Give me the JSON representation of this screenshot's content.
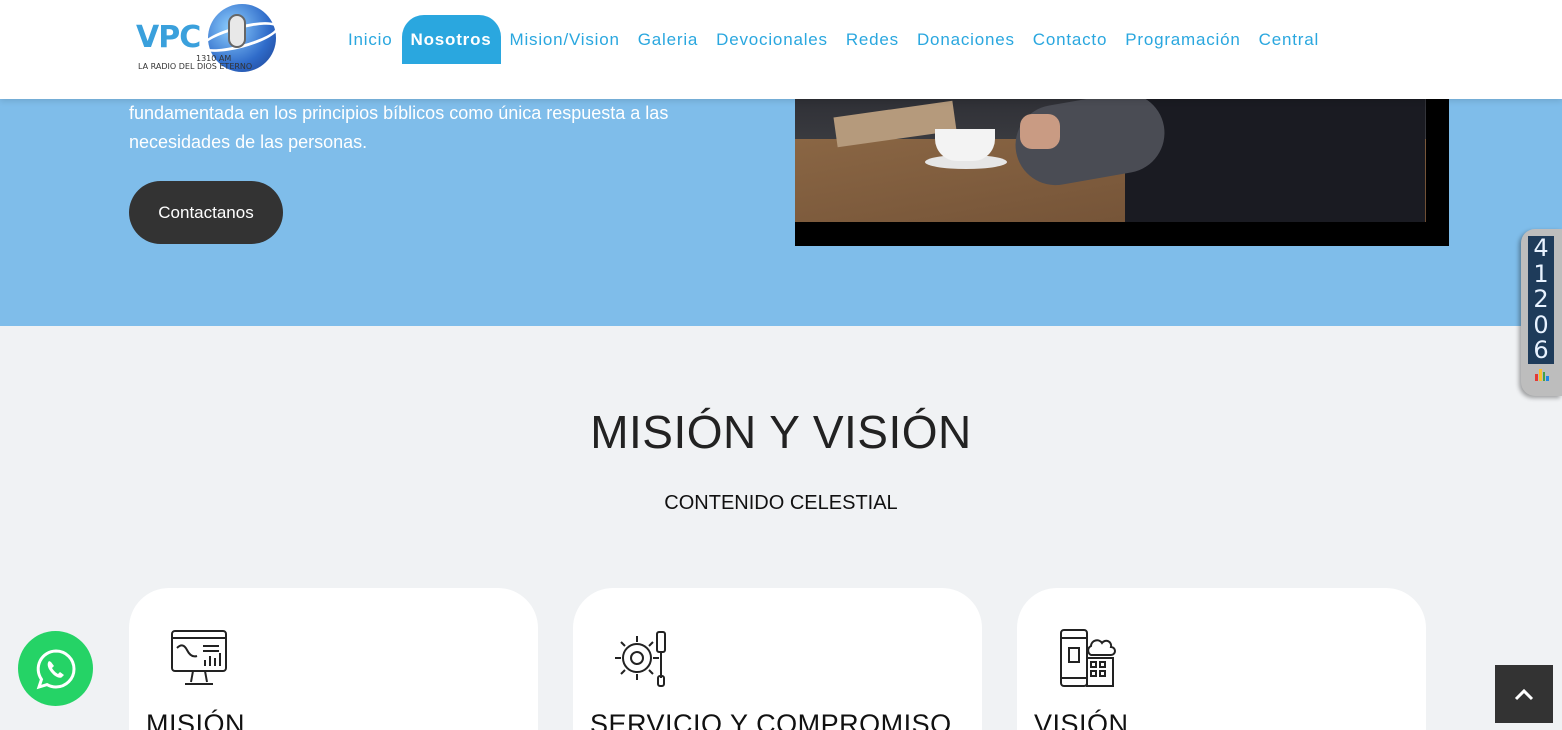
{
  "header": {
    "logo": {
      "text": "VPC",
      "am_label": "1310 AM",
      "tagline": "LA RADIO DEL DIOS ETERNO"
    },
    "nav": [
      {
        "label": "Inicio",
        "active": false
      },
      {
        "label": "Nosotros",
        "active": true
      },
      {
        "label": "Mision/Vision",
        "active": false
      },
      {
        "label": "Galeria",
        "active": false
      },
      {
        "label": "Devocionales",
        "active": false
      },
      {
        "label": "Redes",
        "active": false
      },
      {
        "label": "Donaciones",
        "active": false
      },
      {
        "label": "Contacto",
        "active": false
      },
      {
        "label": "Programación",
        "active": false
      },
      {
        "label": "Central",
        "active": false
      }
    ]
  },
  "hero": {
    "text_line1": "fundamentada en los principios bíblicos como única respuesta a las",
    "text_line2": "necesidades de las personas.",
    "button_label": "Contactanos"
  },
  "counter": {
    "digits": [
      "4",
      "1",
      "2",
      "0",
      "6"
    ],
    "icon": "bar-chart-icon"
  },
  "section": {
    "title": "MISIÓN Y VISIÓN",
    "subtitle": "CONTENIDO CELESTIAL"
  },
  "cards": [
    {
      "title": "MISIÓN",
      "icon": "monitor-dashboard-icon"
    },
    {
      "title": "SERVICIO Y COMPROMISO",
      "icon": "gear-tools-icon"
    },
    {
      "title": "VISIÓN",
      "icon": "building-cloud-icon"
    }
  ],
  "floating": {
    "whatsapp_icon": "whatsapp-icon",
    "scroll_top_icon": "chevron-up-icon"
  },
  "colors": {
    "hero_bg": "#7fbdea",
    "nav_accent": "#2aa7df",
    "button_dark": "#333333",
    "page_bg": "#f0f2f4",
    "whatsapp_green": "#25d366"
  }
}
